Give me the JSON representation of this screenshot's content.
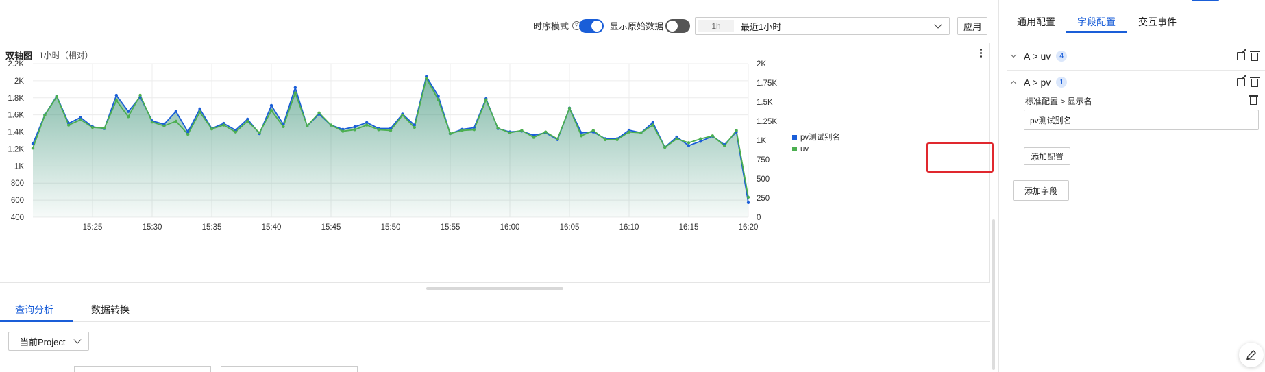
{
  "toolbar": {
    "timeseries_label": "时序模式",
    "timeseries_on": true,
    "raw_data_label": "显示原始数据",
    "raw_data_on": false,
    "time_range_tag": "1h",
    "time_range_text": "最近1小时",
    "apply_label": "应用"
  },
  "chart_panel": {
    "title": "双轴图",
    "subtitle": "1小时（相对）"
  },
  "chart_data": {
    "type": "area",
    "x_ticks": [
      "15:25",
      "15:30",
      "15:35",
      "15:40",
      "15:45",
      "15:50",
      "15:55",
      "16:00",
      "16:05",
      "16:10",
      "16:15",
      "16:20"
    ],
    "left_axis": {
      "ticks": [
        "400",
        "600",
        "800",
        "1K",
        "1.2K",
        "1.4K",
        "1.6K",
        "1.8K",
        "2K",
        "2.2K"
      ],
      "ylim": [
        400,
        2200
      ]
    },
    "right_axis": {
      "ticks": [
        "0",
        "250",
        "500",
        "750",
        "1K",
        "1.25K",
        "1.5K",
        "1.75K",
        "2K"
      ],
      "ylim": [
        0,
        2000
      ]
    },
    "xlim": [
      0,
      60
    ],
    "series": [
      {
        "name": "pv测试别名",
        "color": "#1a5ed8",
        "axis": "left",
        "x": [
          0,
          1,
          2,
          3,
          4,
          5,
          6,
          7,
          8,
          9,
          10,
          11,
          12,
          13,
          14,
          15,
          16,
          17,
          18,
          19,
          20,
          21,
          22,
          23,
          24,
          25,
          26,
          27,
          28,
          29,
          30,
          31,
          32,
          33,
          34,
          35,
          36,
          37,
          38,
          39,
          40,
          41,
          42,
          43,
          44,
          45,
          46,
          47,
          48,
          49,
          50,
          51,
          52,
          53,
          54,
          55,
          56,
          57,
          58,
          59,
          60
        ],
        "values": [
          1260,
          1600,
          1820,
          1500,
          1570,
          1460,
          1440,
          1830,
          1640,
          1810,
          1530,
          1490,
          1640,
          1400,
          1670,
          1440,
          1500,
          1420,
          1550,
          1380,
          1710,
          1490,
          1920,
          1470,
          1610,
          1480,
          1430,
          1460,
          1510,
          1440,
          1440,
          1610,
          1480,
          2050,
          1820,
          1380,
          1430,
          1450,
          1790,
          1440,
          1400,
          1410,
          1360,
          1390,
          1310,
          1680,
          1390,
          1400,
          1320,
          1320,
          1420,
          1390,
          1510,
          1220,
          1340,
          1240,
          1290,
          1350,
          1250,
          1400,
          570
        ]
      },
      {
        "name": "uv",
        "color": "#4caf50",
        "axis": "right",
        "x": [
          0,
          1,
          2,
          3,
          4,
          5,
          6,
          7,
          8,
          9,
          10,
          11,
          12,
          13,
          14,
          15,
          16,
          17,
          18,
          19,
          20,
          21,
          22,
          23,
          24,
          25,
          26,
          27,
          28,
          29,
          30,
          31,
          32,
          33,
          34,
          35,
          36,
          37,
          38,
          39,
          40,
          41,
          42,
          43,
          44,
          45,
          46,
          47,
          48,
          49,
          50,
          51,
          52,
          53,
          54,
          55,
          56,
          57,
          58,
          59,
          60
        ],
        "values": [
          900,
          1330,
          1570,
          1200,
          1270,
          1170,
          1160,
          1520,
          1310,
          1590,
          1240,
          1190,
          1250,
          1080,
          1370,
          1150,
          1200,
          1110,
          1250,
          1100,
          1390,
          1180,
          1620,
          1190,
          1360,
          1200,
          1120,
          1140,
          1200,
          1140,
          1130,
          1330,
          1170,
          1810,
          1530,
          1090,
          1130,
          1140,
          1530,
          1160,
          1100,
          1130,
          1040,
          1110,
          1020,
          1420,
          1060,
          1130,
          1010,
          1010,
          1110,
          1100,
          1200,
          910,
          1020,
          970,
          1020,
          1060,
          930,
          1130,
          260
        ]
      }
    ],
    "legend": [
      "pv测试别名",
      "uv"
    ],
    "legend_position": "right",
    "grid": true
  },
  "bottom_tabs": [
    {
      "label": "查询分析",
      "active": true
    },
    {
      "label": "数据转换",
      "active": false
    }
  ],
  "project_select": {
    "value": "当前Project"
  },
  "right_panel": {
    "tabs": [
      {
        "label": "通用配置",
        "active": false
      },
      {
        "label": "字段配置",
        "active": true
      },
      {
        "label": "交互事件",
        "active": false
      }
    ],
    "fields": [
      {
        "label": "A > uv",
        "count": "4",
        "expanded": false
      },
      {
        "label": "A > pv",
        "count": "1",
        "expanded": true
      }
    ],
    "config_path": "标准配置 > 显示名",
    "display_name_value": "pv测试别名",
    "add_config_label": "添加配置",
    "add_field_label": "添加字段"
  }
}
